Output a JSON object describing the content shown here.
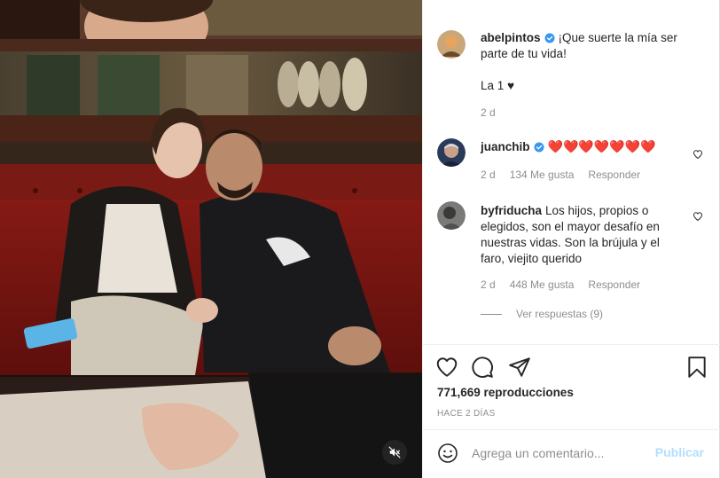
{
  "post": {
    "caption": {
      "username": "abelpintos",
      "verified": true,
      "text_line1": "¡Que suerte la mía ser parte de tu vida!",
      "text_line2": "La 1 ♥",
      "time": "2 d"
    },
    "comments": [
      {
        "username": "juanchib",
        "verified": true,
        "text": "❤️❤️❤️❤️❤️❤️❤️",
        "time": "2 d",
        "likes": "134 Me gusta",
        "reply_label": "Responder"
      },
      {
        "username": "byfriducha",
        "verified": false,
        "text": "Los hijos, propios o elegidos, son el mayor desafío en nuestras vidas. Son la brújula y el faro, viejito querido",
        "time": "2 d",
        "likes": "448 Me gusta",
        "reply_label": "Responder",
        "view_replies": "Ver respuestas (9)"
      }
    ],
    "views": "771,669 reproducciones",
    "posted_ago": "HACE 2 DÍAS"
  },
  "comment_box": {
    "placeholder": "Agrega un comentario...",
    "publish_label": "Publicar"
  },
  "icons": {
    "like": "heart-icon",
    "comment": "comment-bubble-icon",
    "share": "paper-plane-icon",
    "save": "bookmark-icon",
    "emoji": "smiley-icon",
    "mute": "speaker-muted-icon",
    "verified": "verified-badge-icon"
  },
  "colors": {
    "verified": "#3897f0",
    "heart": "#ed4956",
    "secondary_text": "#8e8e8e",
    "publish_disabled": "#b2dffc"
  }
}
